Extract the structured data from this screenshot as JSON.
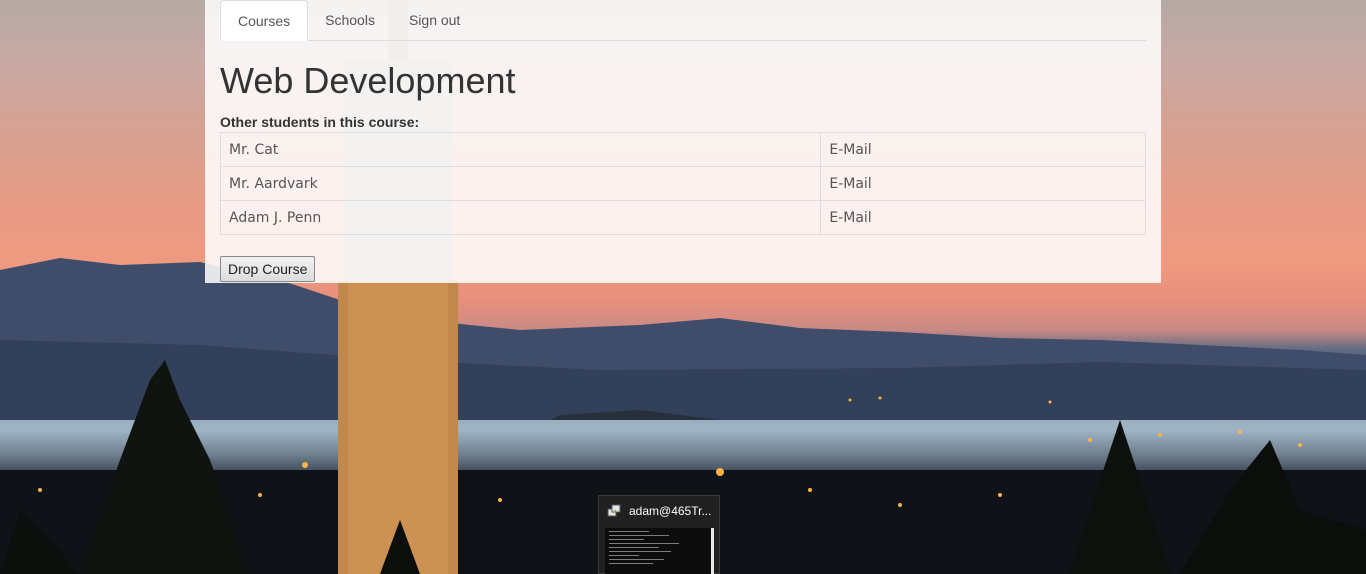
{
  "nav": {
    "tabs": [
      {
        "label": "Courses",
        "active": true
      },
      {
        "label": "Schools",
        "active": false
      },
      {
        "label": "Sign out",
        "active": false
      }
    ]
  },
  "course": {
    "title": "Web Development",
    "students_label": "Other students in this course:",
    "students": [
      {
        "name": "Mr. Cat",
        "email_label": "E-Mail"
      },
      {
        "name": "Mr. Aardvark",
        "email_label": "E-Mail"
      },
      {
        "name": "Adam J. Penn",
        "email_label": "E-Mail"
      }
    ],
    "drop_button_label": "Drop Course"
  },
  "taskbar_preview": {
    "title": "adam@465Tr...",
    "icon": "putty-terminal-icon"
  },
  "colors": {
    "panel_background": "#ffffff",
    "text": "#333333",
    "border": "#dddddd"
  }
}
